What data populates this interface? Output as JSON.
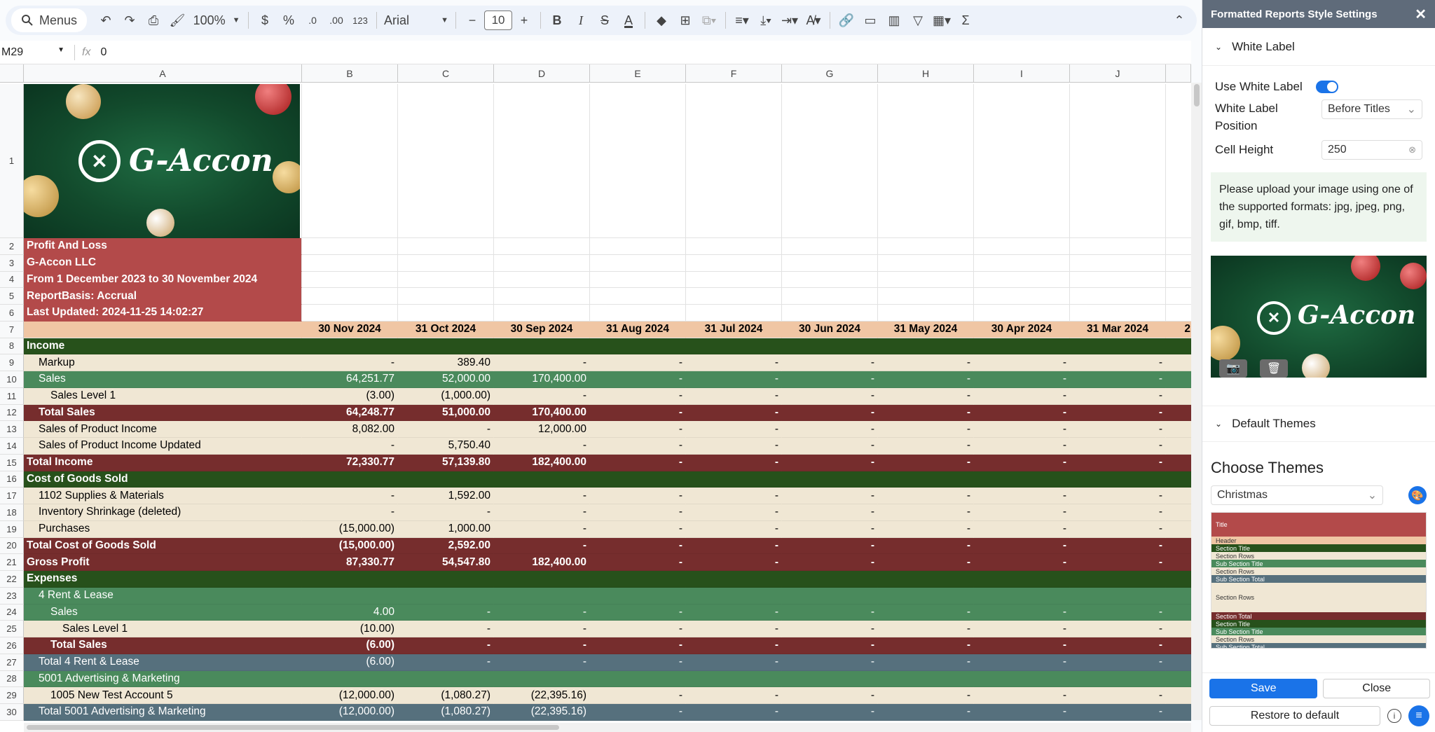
{
  "toolbar": {
    "menus_label": "Menus",
    "zoom": "100%",
    "currency": "$",
    "percent": "%",
    "dec_decrease": ".0",
    "dec_increase": ".00",
    "format_more": "123",
    "font_family": "Arial",
    "font_size": "10"
  },
  "formula_bar": {
    "cell_ref": "M29",
    "fx": "fx",
    "value": "0"
  },
  "columns": [
    "A",
    "B",
    "C",
    "D",
    "E",
    "F",
    "G",
    "H",
    "I",
    "J"
  ],
  "banner_text": "G-Accon",
  "title_rows": [
    {
      "row": "2",
      "text": "Profit And Loss"
    },
    {
      "row": "3",
      "text": "G-Accon LLC"
    },
    {
      "row": "4",
      "text": "From 1 December 2023 to 30 November 2024"
    },
    {
      "row": "5",
      "text": "ReportBasis: Accrual"
    },
    {
      "row": "6",
      "text": "Last Updated: 2024-11-25 14:02:27"
    }
  ],
  "header_row": {
    "row": "7",
    "cells": [
      "",
      "30 Nov 2024",
      "31 Oct 2024",
      "30 Sep 2024",
      "31 Aug 2024",
      "31 Jul 2024",
      "30 Jun 2024",
      "31 May 2024",
      "30 Apr 2024",
      "31 Mar 2024",
      "2"
    ]
  },
  "data_rows": [
    {
      "row": "8",
      "style": "section",
      "cells": [
        "Income",
        "",
        "",
        "",
        "",
        "",
        "",
        "",
        "",
        ""
      ]
    },
    {
      "row": "9",
      "style": "row",
      "indent": 1,
      "cells": [
        "Markup",
        "-",
        "389.40",
        "-",
        "-",
        "-",
        "-",
        "-",
        "-",
        "-"
      ]
    },
    {
      "row": "10",
      "style": "subtitle",
      "indent": 1,
      "cells": [
        "Sales",
        "64,251.77",
        "52,000.00",
        "170,400.00",
        "-",
        "-",
        "-",
        "-",
        "-",
        "-"
      ]
    },
    {
      "row": "11",
      "style": "row",
      "indent": 2,
      "cells": [
        "Sales Level 1",
        "(3.00)",
        "(1,000.00)",
        "-",
        "-",
        "-",
        "-",
        "-",
        "-",
        "-"
      ]
    },
    {
      "row": "12",
      "style": "total",
      "indent": 1,
      "cells": [
        "Total Sales",
        "64,248.77",
        "51,000.00",
        "170,400.00",
        "-",
        "-",
        "-",
        "-",
        "-",
        "-"
      ]
    },
    {
      "row": "13",
      "style": "row",
      "indent": 1,
      "cells": [
        "Sales of Product Income",
        "8,082.00",
        "-",
        "12,000.00",
        "-",
        "-",
        "-",
        "-",
        "-",
        "-"
      ]
    },
    {
      "row": "14",
      "style": "row",
      "indent": 1,
      "cells": [
        "Sales of Product Income Updated",
        "-",
        "5,750.40",
        "-",
        "-",
        "-",
        "-",
        "-",
        "-",
        "-"
      ]
    },
    {
      "row": "15",
      "style": "total",
      "indent": 0,
      "cells": [
        "Total Income",
        "72,330.77",
        "57,139.80",
        "182,400.00",
        "-",
        "-",
        "-",
        "-",
        "-",
        "-"
      ]
    },
    {
      "row": "16",
      "style": "section",
      "cells": [
        "Cost of Goods Sold",
        "",
        "",
        "",
        "",
        "",
        "",
        "",
        "",
        ""
      ]
    },
    {
      "row": "17",
      "style": "row",
      "indent": 1,
      "cells": [
        "1102 Supplies & Materials",
        "-",
        "1,592.00",
        "-",
        "-",
        "-",
        "-",
        "-",
        "-",
        "-"
      ]
    },
    {
      "row": "18",
      "style": "row",
      "indent": 1,
      "cells": [
        "Inventory Shrinkage (deleted)",
        "-",
        "-",
        "-",
        "-",
        "-",
        "-",
        "-",
        "-",
        "-"
      ]
    },
    {
      "row": "19",
      "style": "row",
      "indent": 1,
      "cells": [
        "Purchases",
        "(15,000.00)",
        "1,000.00",
        "-",
        "-",
        "-",
        "-",
        "-",
        "-",
        "-"
      ]
    },
    {
      "row": "20",
      "style": "total",
      "indent": 0,
      "cells": [
        "Total Cost of Goods Sold",
        "(15,000.00)",
        "2,592.00",
        "-",
        "-",
        "-",
        "-",
        "-",
        "-",
        "-"
      ]
    },
    {
      "row": "21",
      "style": "total",
      "indent": 0,
      "cells": [
        "Gross Profit",
        "87,330.77",
        "54,547.80",
        "182,400.00",
        "-",
        "-",
        "-",
        "-",
        "-",
        "-"
      ]
    },
    {
      "row": "22",
      "style": "section",
      "cells": [
        "Expenses",
        "",
        "",
        "",
        "",
        "",
        "",
        "",
        "",
        ""
      ]
    },
    {
      "row": "23",
      "style": "subtitle",
      "indent": 1,
      "cells": [
        "4 Rent & Lease",
        "",
        "",
        "",
        "",
        "",
        "",
        "",
        "",
        ""
      ]
    },
    {
      "row": "24",
      "style": "subtitle",
      "indent": 2,
      "cells": [
        "Sales",
        "4.00",
        "-",
        "-",
        "-",
        "-",
        "-",
        "-",
        "-",
        "-"
      ]
    },
    {
      "row": "25",
      "style": "row",
      "indent": 3,
      "cells": [
        "Sales Level 1",
        "(10.00)",
        "-",
        "-",
        "-",
        "-",
        "-",
        "-",
        "-",
        "-"
      ]
    },
    {
      "row": "26",
      "style": "total",
      "indent": 2,
      "cells": [
        "Total Sales",
        "(6.00)",
        "-",
        "-",
        "-",
        "-",
        "-",
        "-",
        "-",
        "-"
      ]
    },
    {
      "row": "27",
      "style": "subtotal",
      "indent": 1,
      "cells": [
        "Total 4 Rent & Lease",
        "(6.00)",
        "-",
        "-",
        "-",
        "-",
        "-",
        "-",
        "-",
        "-"
      ]
    },
    {
      "row": "28",
      "style": "subtitle",
      "indent": 1,
      "cells": [
        "5001 Advertising & Marketing",
        "",
        "",
        "",
        "",
        "",
        "",
        "",
        "",
        ""
      ]
    },
    {
      "row": "29",
      "style": "row",
      "indent": 2,
      "cells": [
        "1005 New Test Account 5",
        "(12,000.00)",
        "(1,080.27)",
        "(22,395.16)",
        "-",
        "-",
        "-",
        "-",
        "-",
        "-"
      ]
    },
    {
      "row": "30",
      "style": "subtotal",
      "indent": 1,
      "cells": [
        "Total 5001 Advertising & Marketing",
        "(12,000.00)",
        "(1,080.27)",
        "(22,395.16)",
        "-",
        "-",
        "-",
        "-",
        "-",
        "-"
      ]
    }
  ],
  "panel": {
    "title": "Formatted Reports Style Settings",
    "white_label_section": "White Label",
    "use_white_label_label": "Use White Label",
    "position_label": "White Label Position",
    "position_value": "Before Titles",
    "cell_height_label": "Cell Height",
    "cell_height_value": "250",
    "upload_note": "Please upload your image using one of the supported formats: jpg, jpeg, png, gif, bmp, tiff.",
    "default_themes_section": "Default Themes",
    "choose_themes_label": "Choose Themes",
    "theme_value": "Christmas",
    "preview": [
      "Title",
      "Header",
      "Section Title",
      "Section Rows",
      "Sub Section Title",
      "Section Rows",
      "Sub Section Total",
      "Section Rows",
      "Section Total",
      "Section Title",
      "Sub Section Title",
      "Section Rows",
      "Sub Section Total"
    ],
    "save_label": "Save",
    "close_label": "Close",
    "restore_label": "Restore to default"
  },
  "colors": {
    "title_bg": "#b34a4a",
    "header_bg": "#f0c6a4",
    "section_bg": "#27511b",
    "subtitle_bg": "#4a8a5c",
    "row_bg": "#f0e7d4",
    "total_bg": "#762d2d",
    "subtotal_bg": "#56707d",
    "accent": "#1a73e8"
  }
}
